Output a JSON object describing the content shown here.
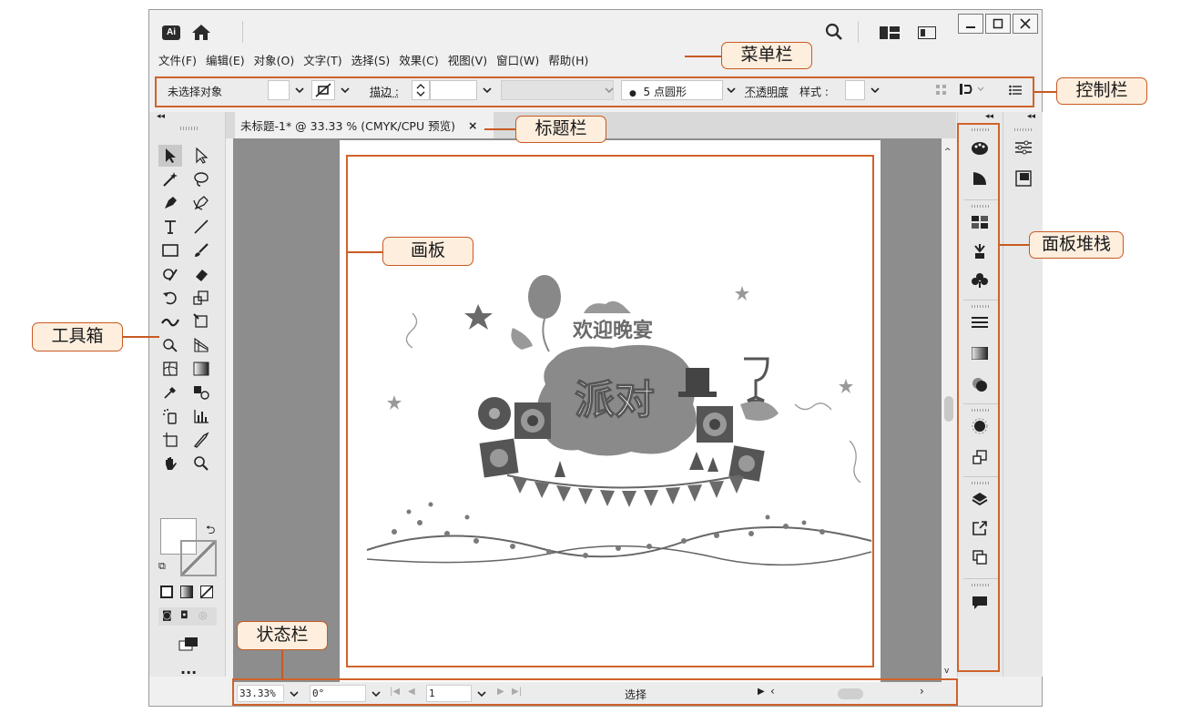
{
  "app": {
    "logo_text": "Ai"
  },
  "menu": {
    "items": [
      "文件(F)",
      "编辑(E)",
      "对象(O)",
      "文字(T)",
      "选择(S)",
      "效果(C)",
      "视图(V)",
      "窗口(W)",
      "帮助(H)"
    ]
  },
  "control_bar": {
    "no_selection": "未选择对象",
    "stroke_label": "描边 :",
    "brush": "5 点圆形",
    "opacity": "不透明度",
    "style_label": "样式 :"
  },
  "document": {
    "tab_title": "未标题-1* @ 33.33 % (CMYK/CPU 预览)",
    "tab_close": "×"
  },
  "artwork": {
    "line1": "欢迎晚宴",
    "line2": "派对"
  },
  "status_bar": {
    "zoom": "33.33%",
    "rotation": "0°",
    "artboard_num": "1",
    "status_text": "选择"
  },
  "callouts": {
    "menu_bar": "菜单栏",
    "control_bar": "控制栏",
    "title_bar": "标题栏",
    "artboard": "画板",
    "panel_stack": "面板堆栈",
    "toolbox": "工具箱",
    "status_bar": "状态栏"
  },
  "colors": {
    "annotation": "#c85a22",
    "annotation_fill": "#fdeede",
    "canvas": "#8d8d8d"
  }
}
